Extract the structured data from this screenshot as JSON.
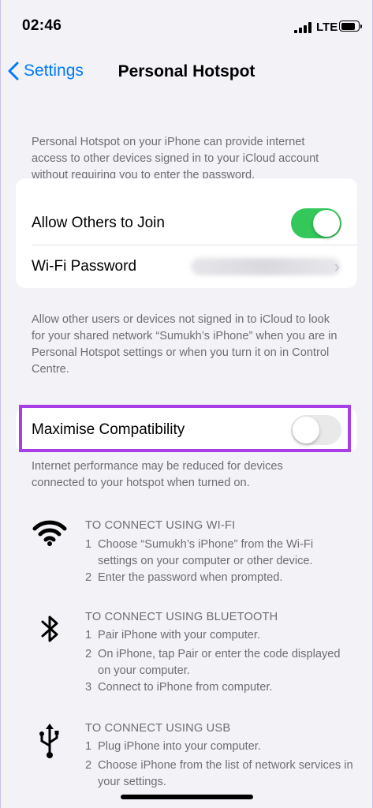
{
  "status_bar": {
    "time": "02:46",
    "network": "LTE",
    "battery_level": 0.85
  },
  "nav": {
    "back_label": "Settings",
    "title": "Personal Hotspot"
  },
  "intro_text": "Personal Hotspot on your iPhone can provide internet access to other devices signed in to your iCloud account without requiring you to enter the password.",
  "hotspot_card": {
    "allow_label": "Allow Others to Join",
    "allow_enabled": true,
    "wifi_password_label": "Wi-Fi Password"
  },
  "allow_footer": "Allow other users or devices not signed in to iCloud to look for your shared network “Sumukh’s iPhone” when you are in Personal Hotspot settings or when you turn it on in Control Centre.",
  "compat_card": {
    "label": "Maximise Compatibility",
    "enabled": false
  },
  "compat_footer": "Internet performance may be reduced for devices connected to your hotspot when turned on.",
  "sections": {
    "wifi": {
      "icon": "wifi-icon",
      "heading": "TO CONNECT USING WI-FI",
      "steps": [
        {
          "num": "1",
          "text": "Choose “Sumukh’s iPhone” from the Wi-Fi settings on your computer or other device."
        },
        {
          "num": "2",
          "text": "Enter the password when prompted."
        }
      ]
    },
    "bluetooth": {
      "icon": "bluetooth-icon",
      "heading": "TO CONNECT USING BLUETOOTH",
      "steps": [
        {
          "num": "1",
          "text": "Pair iPhone with your computer."
        },
        {
          "num": "2",
          "text": "On iPhone, tap Pair or enter the code displayed on your computer."
        },
        {
          "num": "3",
          "text": "Connect to iPhone from computer."
        }
      ]
    },
    "usb": {
      "icon": "usb-icon",
      "heading": "TO CONNECT USING USB",
      "steps": [
        {
          "num": "1",
          "text": "Plug iPhone into your computer."
        },
        {
          "num": "2",
          "text": "Choose iPhone from the list of network services in your settings."
        }
      ]
    }
  },
  "colors": {
    "accent": "#007aff",
    "toggle_on": "#34c759",
    "toggle_off": "#e9e9ea",
    "highlight": "#a83ee6"
  }
}
